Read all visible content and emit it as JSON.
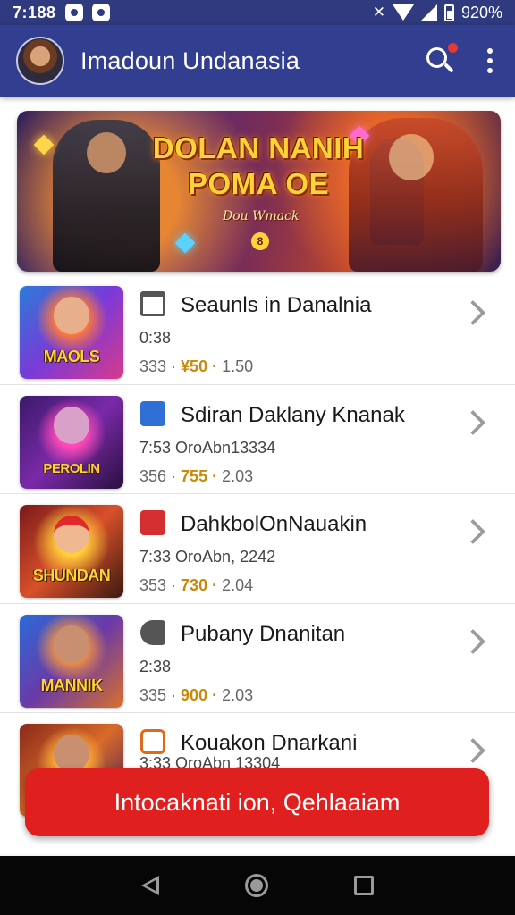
{
  "status_bar": {
    "time": "7:188",
    "battery": "920%"
  },
  "app_bar": {
    "title": "Imadoun Undanasia"
  },
  "banner": {
    "title_line1": "DOLAN NANIH",
    "title_line2": "POMA OE",
    "subtitle": "Dou Wmack",
    "badge": "8"
  },
  "games": [
    {
      "title": "Seaunls in Danalnia",
      "meta": "0:38",
      "stat_left": "333 ·",
      "price": "¥50 ·",
      "stat_right": "1.50",
      "thumb_text": "MAOLS",
      "icon": "trash-icon",
      "icon_color": "#555555"
    },
    {
      "title": "Sdiran Daklany Knanak",
      "meta": "7:53 OroAbn13334",
      "stat_left": "356 ·",
      "price": "755 ·",
      "stat_right": "2.03",
      "thumb_text": "PEROLIN",
      "icon": "send-icon",
      "icon_color": "#2f6fd6"
    },
    {
      "title": "DahkbolOnNauakin",
      "meta": "7:33 OroAbn, 2242",
      "stat_left": "353 ·",
      "price": "730 ·",
      "stat_right": "2.04",
      "thumb_text": "SHUNDAN",
      "icon": "game-icon",
      "icon_color": "#d32f2f"
    },
    {
      "title": "Pubany Dnanitan",
      "meta": "2:38",
      "stat_left": "335 ·",
      "price": "900 ·",
      "stat_right": "2.03",
      "thumb_text": "MANNIK",
      "icon": "tag-icon",
      "icon_color": "#555555"
    },
    {
      "title": "Kouakon Dnarkani",
      "meta": "3:33 OroAbn 13304",
      "stat_left": "",
      "price": "",
      "stat_right": "",
      "thumb_text": "",
      "icon": "chat-icon",
      "icon_color": "#e06a1a"
    }
  ],
  "cta": {
    "label": "Intocaknati ion, Qehlaaiam"
  }
}
